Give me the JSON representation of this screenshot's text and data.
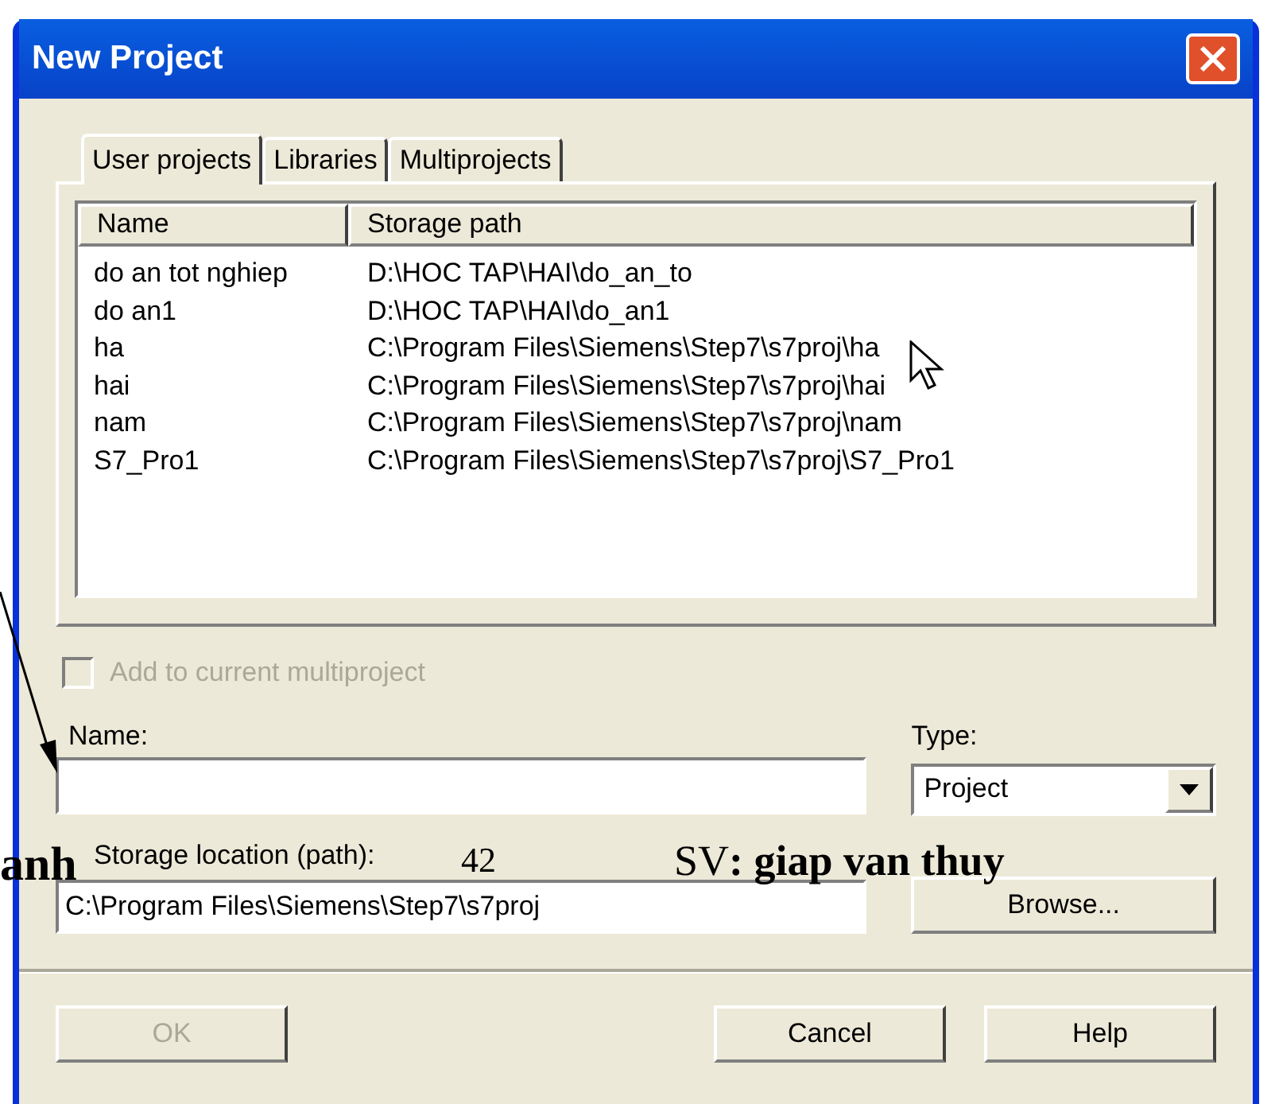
{
  "window": {
    "title": "New Project"
  },
  "tabs": [
    {
      "label": "User projects",
      "selected": true
    },
    {
      "label": "Libraries",
      "selected": false
    },
    {
      "label": "Multiprojects",
      "selected": false
    }
  ],
  "table": {
    "columns": [
      "Name",
      "Storage path"
    ],
    "rows": [
      [
        "do an tot nghiep",
        "D:\\HOC TAP\\HAI\\do_an_to"
      ],
      [
        "do an1",
        "D:\\HOC TAP\\HAI\\do_an1"
      ],
      [
        "ha",
        "C:\\Program Files\\Siemens\\Step7\\s7proj\\ha"
      ],
      [
        "hai",
        "C:\\Program Files\\Siemens\\Step7\\s7proj\\hai"
      ],
      [
        "nam",
        "C:\\Program Files\\Siemens\\Step7\\s7proj\\nam"
      ],
      [
        "S7_Pro1",
        "C:\\Program Files\\Siemens\\Step7\\s7proj\\S7_Pro1"
      ]
    ]
  },
  "add_to_multiproject": {
    "label": "Add to current multiproject",
    "checked": false,
    "disabled": true
  },
  "name_field": {
    "label": "Name:"
  },
  "type_field": {
    "label": "Type:",
    "value": "Project"
  },
  "storage_field": {
    "label": "Storage location (path):",
    "value": "C:\\Program Files\\Siemens\\Step7\\s7proj"
  },
  "browse_button": "Browse...",
  "buttons": [
    {
      "label": "OK",
      "disabled": true
    },
    {
      "label": "Cancel",
      "disabled": false
    },
    {
      "label": "Help",
      "disabled": false
    }
  ],
  "document_overlay": [
    "anh",
    "42",
    "SV**: giap van thuy**"
  ]
}
